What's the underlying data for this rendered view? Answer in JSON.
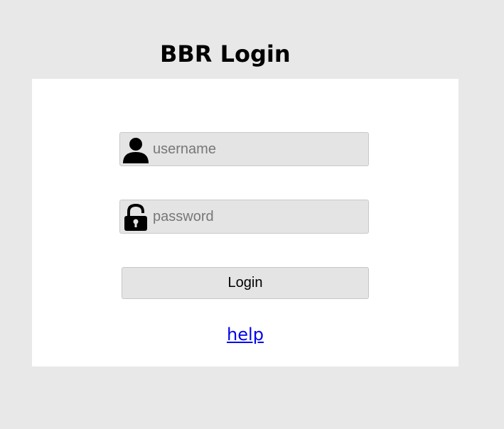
{
  "header": {
    "title": "BBR Login"
  },
  "form": {
    "username": {
      "placeholder": "username",
      "value": "",
      "icon": "user-icon"
    },
    "password": {
      "placeholder": "password",
      "value": "",
      "icon": "lock-icon"
    },
    "login_label": "Login",
    "help_label": "help"
  },
  "colors": {
    "background": "#e8e8e8",
    "panel": "#ffffff",
    "field": "#e4e4e4",
    "link": "#0000ee"
  }
}
